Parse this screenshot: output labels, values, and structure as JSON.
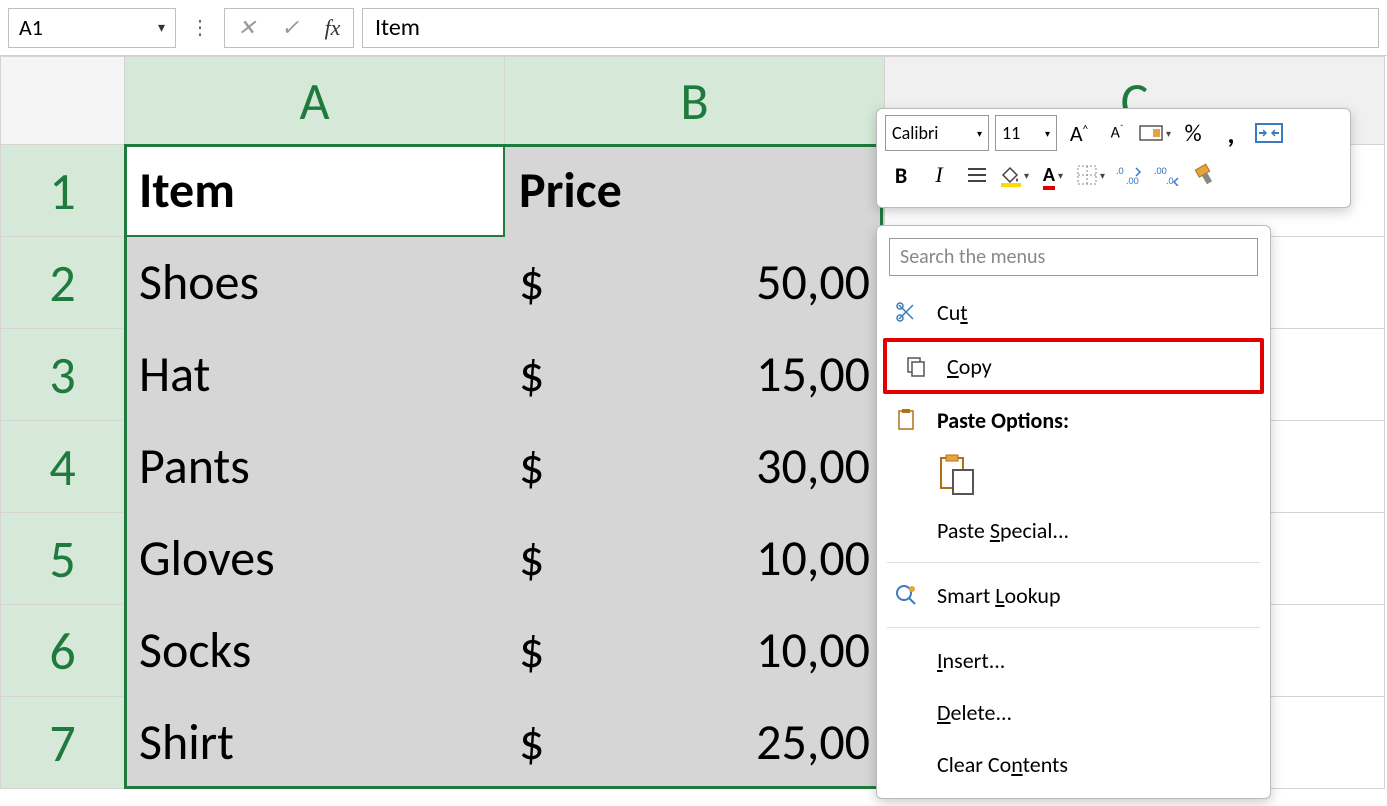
{
  "formula_bar": {
    "name_box": "A1",
    "formula_value": "Item"
  },
  "columns": [
    "A",
    "B",
    "C"
  ],
  "rows": [
    {
      "n": "1",
      "a": "Item",
      "b": "Price",
      "currency": ""
    },
    {
      "n": "2",
      "a": "Shoes",
      "b": "50,00",
      "currency": "$"
    },
    {
      "n": "3",
      "a": "Hat",
      "b": "15,00",
      "currency": "$"
    },
    {
      "n": "4",
      "a": "Pants",
      "b": "30,00",
      "currency": "$"
    },
    {
      "n": "5",
      "a": "Gloves",
      "b": "10,00",
      "currency": "$"
    },
    {
      "n": "6",
      "a": "Socks",
      "b": "10,00",
      "currency": "$"
    },
    {
      "n": "7",
      "a": "Shirt",
      "b": "25,00",
      "currency": "$"
    }
  ],
  "mini_toolbar": {
    "font_name": "Calibri",
    "font_size": "11",
    "percent": "%",
    "comma": ","
  },
  "context_menu": {
    "search_placeholder": "Search the menus",
    "cut": "Cut",
    "copy": "Copy",
    "paste_options": "Paste Options:",
    "paste_special": "Paste Special...",
    "smart_lookup": "Smart Lookup",
    "insert": "Insert...",
    "delete": "Delete...",
    "clear_contents": "Clear Contents"
  }
}
